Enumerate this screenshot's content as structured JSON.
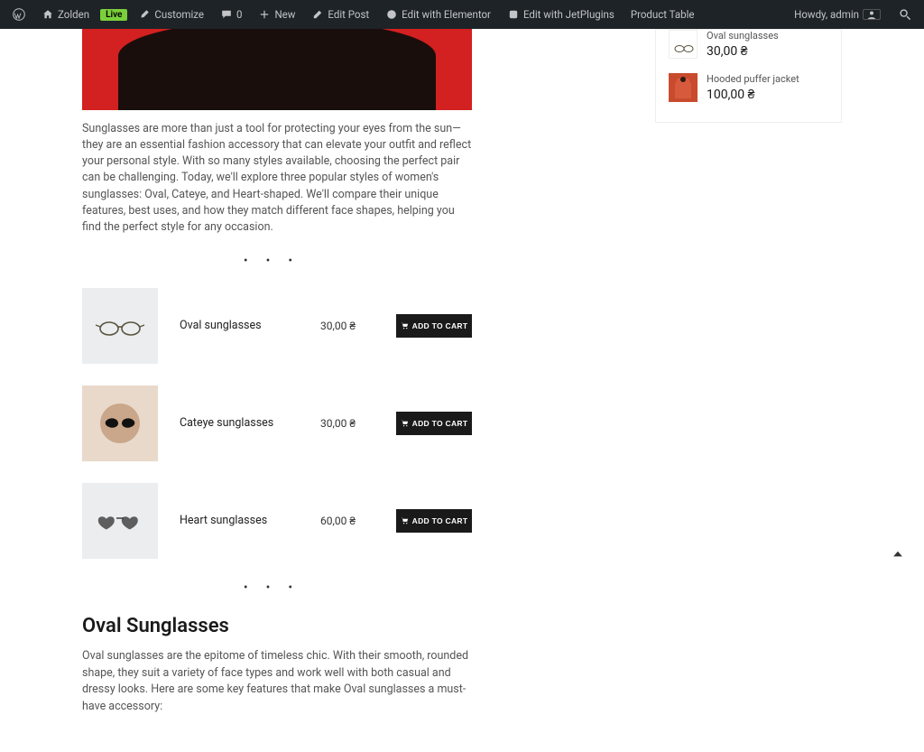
{
  "adminbar": {
    "site_name": "Zolden",
    "live_badge": "Live",
    "customize": "Customize",
    "comments_count": "0",
    "new": "New",
    "edit_post": "Edit Post",
    "edit_elementor": "Edit with Elementor",
    "edit_jetplugins": "Edit with JetPlugins",
    "product_table": "Product Table",
    "howdy": "Howdy, admin"
  },
  "article": {
    "intro": "Sunglasses are more than just a tool for protecting your eyes from the sun—they are an essential fashion accessory that can elevate your outfit and reflect your personal style. With so many styles available, choosing the perfect pair can be challenging. Today, we'll explore three popular styles of women's sunglasses: Oval, Cateye, and Heart-shaped. We'll compare their unique features, best uses, and how they match different face shapes, helping you find the perfect style for any occasion.",
    "heading": "Oval Sunglasses",
    "body": "Oval sunglasses are the epitome of timeless chic. With their smooth, rounded shape, they suit a variety of face types and work well with both casual and dressy looks. Here are some key features that make Oval sunglasses a must-have accessory:"
  },
  "products": [
    {
      "name": "Oval sunglasses",
      "price": "30,00 ₴",
      "cta": "ADD TO CART",
      "thumb": "oval"
    },
    {
      "name": "Cateye sunglasses",
      "price": "30,00 ₴",
      "cta": "ADD TO CART",
      "thumb": "cateye"
    },
    {
      "name": "Heart sunglasses",
      "price": "60,00 ₴",
      "cta": "ADD TO CART",
      "thumb": "heart"
    }
  ],
  "sidebar": {
    "items": [
      {
        "title": "Oval sunglasses",
        "price": "30,00 ₴",
        "thumb": "oval"
      },
      {
        "title": "Hooded puffer jacket",
        "price": "100,00 ₴",
        "thumb": "jacket"
      }
    ]
  }
}
